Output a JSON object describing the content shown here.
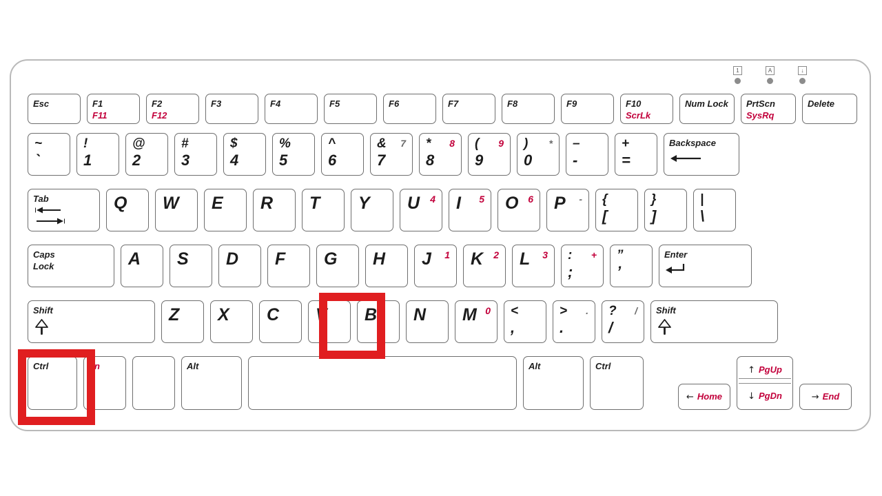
{
  "diagram": {
    "title": "Laptop keyboard layout diagram",
    "accent_red": "#c2003b",
    "highlight_red": "#e01e20",
    "key_border": "#6e6e6e",
    "background": "#ffffff"
  },
  "indicators": [
    {
      "name": "num-lock-led",
      "glyph": "1"
    },
    {
      "name": "caps-lock-led",
      "glyph": "A"
    },
    {
      "name": "scroll-lock-led",
      "glyph": "↓"
    }
  ],
  "rows": {
    "function_row": [
      {
        "main": "Esc"
      },
      {
        "main": "F1",
        "sub": "F11"
      },
      {
        "main": "F2",
        "sub": "F12"
      },
      {
        "main": "F3"
      },
      {
        "main": "F4"
      },
      {
        "main": "F5"
      },
      {
        "main": "F6"
      },
      {
        "main": "F7"
      },
      {
        "main": "F8"
      },
      {
        "main": "F9"
      },
      {
        "main": "F10",
        "sub": "ScrLk"
      },
      {
        "main": "Num Lock"
      },
      {
        "main": "PrtScn",
        "sub": "SysRq"
      },
      {
        "main": "Delete"
      }
    ],
    "number_row": [
      {
        "up": "~",
        "dn": "`"
      },
      {
        "up": "!",
        "dn": "1"
      },
      {
        "up": "@",
        "dn": "2"
      },
      {
        "up": "#",
        "dn": "3"
      },
      {
        "up": "$",
        "dn": "4"
      },
      {
        "up": "%",
        "dn": "5"
      },
      {
        "up": "^",
        "dn": "6"
      },
      {
        "up": "&",
        "dn": "7",
        "num": "7",
        "num_color": "grey"
      },
      {
        "up": "*",
        "dn": "8",
        "num": "8",
        "num_color": "red"
      },
      {
        "up": "(",
        "dn": "9",
        "num": "9",
        "num_color": "red"
      },
      {
        "up": ")",
        "dn": "0",
        "num": "*",
        "num_color": "grey"
      },
      {
        "up": "–",
        "dn": "-"
      },
      {
        "up": "+",
        "dn": "="
      },
      {
        "main": "Backspace",
        "icon": "arrow-left"
      }
    ],
    "qwerty_row": [
      {
        "main": "Tab",
        "icon": "tab-arrows"
      },
      {
        "big": "Q"
      },
      {
        "big": "W"
      },
      {
        "big": "E"
      },
      {
        "big": "R"
      },
      {
        "big": "T"
      },
      {
        "big": "Y"
      },
      {
        "big": "U",
        "num": "4",
        "num_color": "red"
      },
      {
        "big": "I",
        "num": "5",
        "num_color": "red"
      },
      {
        "big": "O",
        "num": "6",
        "num_color": "red"
      },
      {
        "big": "P",
        "num": "-",
        "num_color": "grey"
      },
      {
        "up": "{",
        "dn": "["
      },
      {
        "up": "}",
        "dn": "]"
      },
      {
        "up": "|",
        "dn": "\\"
      }
    ],
    "home_row": [
      {
        "main": "Caps",
        "sub": "Lock"
      },
      {
        "big": "A"
      },
      {
        "big": "S"
      },
      {
        "big": "D"
      },
      {
        "big": "F"
      },
      {
        "big": "G"
      },
      {
        "big": "H"
      },
      {
        "big": "J",
        "num": "1",
        "num_color": "red"
      },
      {
        "big": "K",
        "num": "2",
        "num_color": "red"
      },
      {
        "big": "L",
        "num": "3",
        "num_color": "red"
      },
      {
        "up": ":",
        "dn": ";",
        "num": "+",
        "num_color": "red"
      },
      {
        "up": "”",
        "dn": "’"
      },
      {
        "main": "Enter",
        "icon": "arrow-return"
      }
    ],
    "shift_row": [
      {
        "main": "Shift",
        "icon": "arrow-up-outline"
      },
      {
        "big": "Z"
      },
      {
        "big": "X"
      },
      {
        "big": "C"
      },
      {
        "big": "V",
        "highlight": true
      },
      {
        "big": "B"
      },
      {
        "big": "N"
      },
      {
        "big": "M",
        "num": "0",
        "num_color": "red"
      },
      {
        "up": "<",
        "dn": ","
      },
      {
        "up": ">",
        "dn": ".",
        "num": ".",
        "num_color": "grey"
      },
      {
        "up": "?",
        "dn": "/",
        "num": "/",
        "num_color": "grey"
      },
      {
        "main": "Shift",
        "icon": "arrow-up-outline"
      }
    ],
    "bottom_row": [
      {
        "main": "Ctrl",
        "highlight": true
      },
      {
        "main": "Fn",
        "color": "red"
      },
      {
        "main": ""
      },
      {
        "main": "Alt"
      },
      {
        "main": ""
      },
      {
        "main": "Alt"
      },
      {
        "main": "Ctrl"
      }
    ],
    "nav_cluster": [
      {
        "arrow": "←",
        "word": "Home"
      },
      {
        "arrow": "↑",
        "word": "PgUp"
      },
      {
        "arrow": "↓",
        "word": "PgDn"
      },
      {
        "arrow": "→",
        "word": "End"
      }
    ]
  }
}
